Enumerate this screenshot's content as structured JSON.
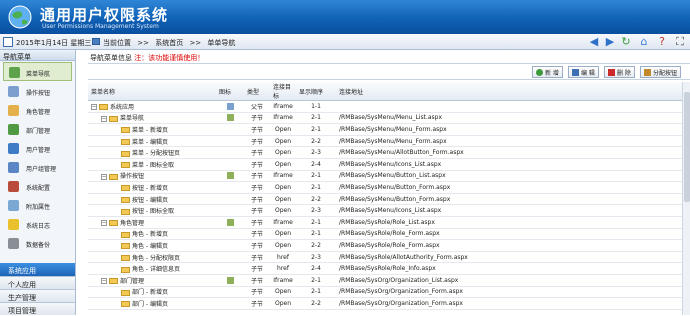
{
  "header": {
    "title": "通用用户权限系统",
    "subtitle": "User Permissions Management System"
  },
  "toolbar": {
    "date": "2015年1月14日 星期三",
    "breadcrumb": [
      "当前位置",
      ">>",
      "系统首页",
      ">>",
      "单单导航"
    ]
  },
  "left_panel": {
    "title": "导航菜单",
    "items": [
      {
        "label": "菜单导航",
        "icon": "menu-icon",
        "color": "#5fa24c",
        "active": true
      },
      {
        "label": "操作按钮",
        "icon": "pointer-icon",
        "color": "#7d9fcf"
      },
      {
        "label": "角色管理",
        "icon": "roles-icon",
        "color": "#e3b04b"
      },
      {
        "label": "部门管理",
        "icon": "org-icon",
        "color": "#4f9a43"
      },
      {
        "label": "用户管理",
        "icon": "user-icon",
        "color": "#3f7cc6"
      },
      {
        "label": "用户组管理",
        "icon": "user-group-icon",
        "color": "#5a86c5"
      },
      {
        "label": "系统配置",
        "icon": "tools-icon",
        "color": "#b94b3c"
      },
      {
        "label": "附加属性",
        "icon": "attribute-icon",
        "color": "#7aa7d4"
      },
      {
        "label": "系统日志",
        "icon": "warning-icon",
        "color": "#e8c12c"
      },
      {
        "label": "数据备份",
        "icon": "backup-icon",
        "color": "#8a8f96"
      }
    ],
    "sections": [
      "系统应用",
      "个人应用",
      "生产管理",
      "项目管理"
    ]
  },
  "main": {
    "info_title": "导航菜单信息",
    "info_warn": "注：该功能谨慎使用！",
    "buttons": [
      {
        "label": "新 增",
        "icon": "add-icon",
        "color": "#3b9a3b"
      },
      {
        "label": "编 辑",
        "icon": "edit-icon",
        "color": "#3d6fb2"
      },
      {
        "label": "删 除",
        "icon": "delete-icon",
        "color": "#cc2a2a"
      },
      {
        "label": "分配按钮",
        "icon": "assign-icon",
        "color": "#c08a2a"
      }
    ],
    "columns": [
      "菜单名称",
      "图标",
      "类型",
      "连接目标",
      "显示顺序",
      "连接地址"
    ],
    "rows": [
      {
        "name": "系统应用",
        "level": 0,
        "tog": "−",
        "type": "父节",
        "target": "Iframe",
        "order": "1-1",
        "url": ""
      },
      {
        "name": "菜单导航",
        "level": 1,
        "tog": "−",
        "type": "子节",
        "target": "Iframe",
        "order": "2-1",
        "url": "/RMBase/SysMenu/Menu_List.aspx"
      },
      {
        "name": "菜单 - 新增页",
        "level": 2,
        "type": "子节",
        "target": "Open",
        "order": "2-1",
        "url": "/RMBase/SysMenu/Menu_Form.aspx"
      },
      {
        "name": "菜单 - 编辑页",
        "level": 2,
        "type": "子节",
        "target": "Open",
        "order": "2-2",
        "url": "/RMBase/SysMenu/Menu_Form.aspx"
      },
      {
        "name": "菜单 - 分配按钮页",
        "level": 2,
        "type": "子节",
        "target": "Open",
        "order": "2-3",
        "url": "/RMBase/SysMenu/AllotButton_Form.aspx"
      },
      {
        "name": "菜单 - 图标全取",
        "level": 2,
        "type": "子节",
        "target": "Open",
        "order": "2-4",
        "url": "/RMBase/SysMenu/Icons_List.aspx"
      },
      {
        "name": "操作按钮",
        "level": 1,
        "tog": "−",
        "type": "子节",
        "target": "Iframe",
        "order": "2-1",
        "url": "/RMBase/SysMenu/Button_List.aspx"
      },
      {
        "name": "按钮 - 新增页",
        "level": 2,
        "type": "子节",
        "target": "Open",
        "order": "2-1",
        "url": "/RMBase/SysMenu/Button_Form.aspx"
      },
      {
        "name": "按钮 - 编辑页",
        "level": 2,
        "type": "子节",
        "target": "Open",
        "order": "2-2",
        "url": "/RMBase/SysMenu/Button_Form.aspx"
      },
      {
        "name": "按钮 - 图标全取",
        "level": 2,
        "type": "子节",
        "target": "Open",
        "order": "2-3",
        "url": "/RMBase/SysMenu/Icons_List.aspx"
      },
      {
        "name": "角色管理",
        "level": 1,
        "tog": "−",
        "type": "子节",
        "target": "Iframe",
        "order": "2-1",
        "url": "/RMBase/SysRole/Role_List.aspx"
      },
      {
        "name": "角色 - 新增页",
        "level": 2,
        "type": "子节",
        "target": "Open",
        "order": "2-1",
        "url": "/RMBase/SysRole/Role_Form.aspx"
      },
      {
        "name": "角色 - 编辑页",
        "level": 2,
        "type": "子节",
        "target": "Open",
        "order": "2-2",
        "url": "/RMBase/SysRole/Role_Form.aspx"
      },
      {
        "name": "角色 - 分配权限页",
        "level": 2,
        "type": "子节",
        "target": "href",
        "order": "2-3",
        "url": "/RMBase/SysRole/AllotAuthority_Form.aspx"
      },
      {
        "name": "角色 - 详细信息页",
        "level": 2,
        "type": "子节",
        "target": "href",
        "order": "2-4",
        "url": "/RMBase/SysRole/Role_Info.aspx"
      },
      {
        "name": "部门管理",
        "level": 1,
        "tog": "−",
        "type": "子节",
        "target": "Iframe",
        "order": "2-1",
        "url": "/RMBase/SysOrg/Organization_List.aspx"
      },
      {
        "name": "部门 - 新增页",
        "level": 2,
        "type": "子节",
        "target": "Open",
        "order": "2-1",
        "url": "/RMBase/SysOrg/Organization_Form.aspx"
      },
      {
        "name": "部门 - 编辑页",
        "level": 2,
        "type": "子节",
        "target": "Open",
        "order": "2-2",
        "url": "/RMBase/SysOrg/Organization_Form.aspx"
      }
    ]
  }
}
